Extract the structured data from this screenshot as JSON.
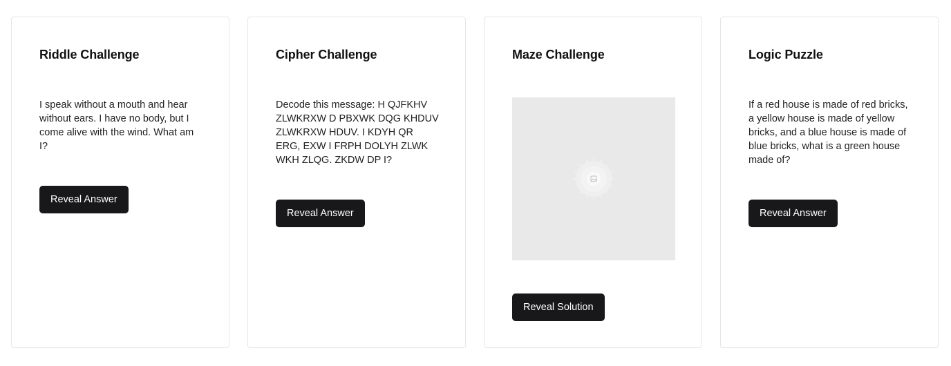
{
  "cards": [
    {
      "title": "Riddle Challenge",
      "text": "I speak without a mouth and hear without ears. I have no body, but I come alive with the wind. What am I?",
      "button_label": "Reveal Answer"
    },
    {
      "title": "Cipher Challenge",
      "text": "Decode this message: H QJFKHV ZLWKRXW D PBXWK DQG KHDUV ZLWKRXW HDUV. I KDYH QR ERG, EXW I FRPH DOLYH ZLWK WKH ZLQG. ZKDW DP I?",
      "button_label": "Reveal Answer"
    },
    {
      "title": "Maze Challenge",
      "image_icon": "image-placeholder-icon",
      "button_label": "Reveal Solution"
    },
    {
      "title": "Logic Puzzle",
      "text": "If a red house is made of red bricks, a yellow house is made of yellow bricks, and a blue house is made of blue bricks, what is a green house made of?",
      "button_label": "Reveal Answer"
    }
  ],
  "colors": {
    "button_bg": "#18181b",
    "card_border": "#e6e6e6",
    "placeholder_bg": "#e9e9e9"
  }
}
